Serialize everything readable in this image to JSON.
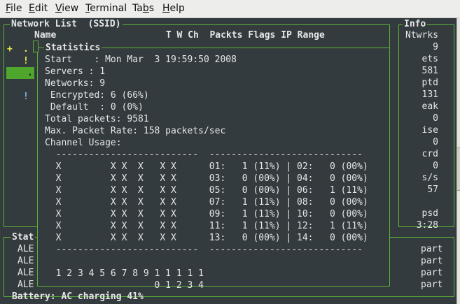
{
  "menubar": {
    "items": [
      {
        "name": "menu-file",
        "label": "File",
        "mnemonic": "F"
      },
      {
        "name": "menu-edit",
        "label": "Edit",
        "mnemonic": "E"
      },
      {
        "name": "menu-view",
        "label": "View",
        "mnemonic": "V"
      },
      {
        "name": "menu-terminal",
        "label": "Terminal",
        "mnemonic": "T"
      },
      {
        "name": "menu-tabs",
        "label": "Tabs",
        "mnemonic": "b"
      },
      {
        "name": "menu-help",
        "label": "Help",
        "mnemonic": "H"
      }
    ]
  },
  "network_list": {
    "title": "Network List  (SSID)",
    "header": "Name                    T W Ch  Packts Flags IP Range",
    "flags": [
      "+",
      ".",
      "!",
      ".",
      "!"
    ]
  },
  "info_panel": {
    "title": "Info",
    "rows": [
      "Ntwrks",
      "9",
      "ets",
      "581",
      "ptd",
      "131",
      "eak",
      "0",
      "ise",
      "0",
      "crd",
      "0",
      "s/s",
      "57",
      "",
      "psd",
      "3:28"
    ]
  },
  "status_panel": {
    "title": "Stat",
    "lines": [
      "ALE",
      "ALE",
      "ALE",
      "ALE"
    ],
    "right": [
      "part",
      "part",
      "part",
      "part"
    ]
  },
  "statistics": {
    "title": "Statistics",
    "lines": [
      "Start    : Mon Mar  3 19:59:50 2008",
      "Servers : 1",
      "Networks: 9",
      " Encrypted: 6 (66%)",
      " Default  : 0 (0%)",
      "Total packets: 9581",
      "Max. Packet Rate: 158 packets/sec",
      "Channel Usage:",
      "  --------------------------  ----------------------------",
      "  X         X X  X   X X      01:   1 (11%) | 02:   0 (00%)",
      "  X         X X  X   X X      03:   0 (00%) | 04:   0 (00%)",
      "  X         X X  X   X X      05:   0 (00%) | 06:   1 (11%)",
      "  X         X X  X   X X      07:   1 (11%) | 08:   0 (00%)",
      "  X         X X  X   X X      09:   1 (11%) | 10:   0 (00%)",
      "  X         X X  X   X X      11:   1 (11%) | 12:   1 (11%)",
      "  X         X X  X   X X      13:   0 (00%) | 14:   0 (00%)",
      "  --------------------------  ----------------------------",
      "",
      "  1 2 3 4 5 6 7 8 9 1 1 1 1 1",
      "                    0 1 2 3 4"
    ]
  },
  "battery": {
    "text": "Battery: AC charging 41%"
  },
  "colors": {
    "background": "#333b3f",
    "frame": "#5cb335",
    "highlight": "#4ea62d",
    "flag": "#e8e84a",
    "text": "#e6e6e6"
  }
}
